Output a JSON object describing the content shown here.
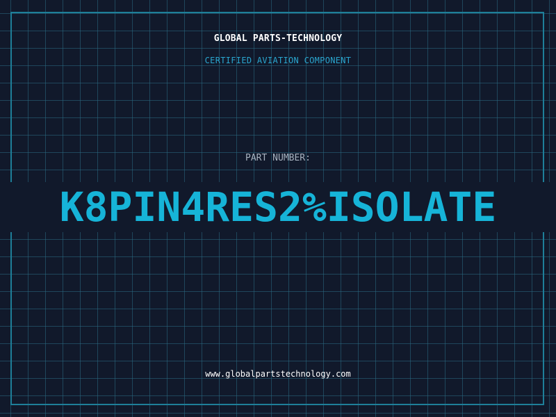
{
  "header": {
    "company": "GLOBAL PARTS-TECHNOLOGY",
    "subtitle": "CERTIFIED AVIATION COMPONENT"
  },
  "part": {
    "label": "PART NUMBER:",
    "value": "K8PIN4RES2%ISOLATE"
  },
  "footer": {
    "website": "www.globalpartstechnology.com"
  },
  "colors": {
    "background": "#11192b",
    "grid": "#2a6c84",
    "accent": "#16b4d8",
    "subtitle": "#2aa6cf",
    "label": "#a8b3c0",
    "text": "#ffffff"
  }
}
